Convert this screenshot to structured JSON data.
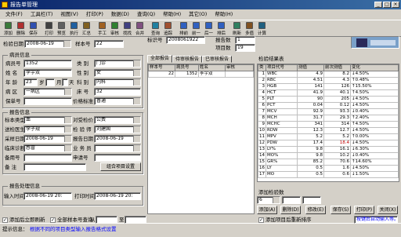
{
  "window": {
    "title": "报告单管理"
  },
  "menu": [
    "文件(F)",
    "工具栏(T)",
    "视图(V)",
    "打印(P)",
    "数据(D)",
    "查询(Q)",
    "帮助(H)",
    "其它(O)",
    "帮助(H)"
  ],
  "toolbar": {
    "buttons": [
      "添加",
      "删除",
      "保存",
      "打印",
      "预览",
      "执行",
      "汇总",
      "手工",
      "审核",
      "找找",
      "合并",
      "查询",
      "追踪",
      "排前",
      "前一",
      "后一",
      "排后",
      "刷新",
      "多值",
      "计算"
    ]
  },
  "top": {
    "sample_date_label": "检验日期",
    "sample_date": "2008-06-19",
    "sample_no_label": "样本号",
    "sample_no": "22",
    "barcode_label": "标识号",
    "barcode": "2008061922",
    "report_count_label": "报告数",
    "report_count": "1",
    "item_count_label": "项目数",
    "item_count": "19"
  },
  "patient": {
    "group_title": "病员信息",
    "case_no_label": "病员号",
    "case_no": "1352",
    "type_label": "类 别",
    "type": "门诊",
    "name_label": "姓 名",
    "name": "李宇双",
    "sex_label": "性 别",
    "sex": "女",
    "age_label": "年 龄",
    "age": "23",
    "age_unit1": "岁",
    "age_unit2": "月",
    "age_unit3": "天",
    "dept_label": "科 别",
    "dept": "内科",
    "ward_label": "病 区",
    "ward": "一病区",
    "bed_label": "床 号",
    "bed": "32",
    "insure_label": "保单号",
    "insure": "",
    "price_label": "价格标准",
    "price": "普通"
  },
  "report": {
    "group_title": "报告信息",
    "sample_type_label": "标本类型",
    "sample_type": "血",
    "ctrl_label": "对受检价",
    "ctrl": "公费",
    "doctor_label": "送检医生",
    "doctor": "李子规",
    "checker_label": "检 验 师",
    "checker": "刘建国",
    "collect_label": "采样日期",
    "collect": "2008-06-19",
    "report_date_label": "报告日期",
    "report_date": "2008-06-19",
    "clinic_label": "临床诊断",
    "clinic": "感冒",
    "op_label": "业 务 员",
    "op": "",
    "note_label": "备用号",
    "note": "",
    "applyno_label": "申请号",
    "applyno": "",
    "remark_label": "备 注",
    "remark": "",
    "combo_btn": "组合项目设置"
  },
  "process": {
    "group_title": "报告处理信息",
    "input_time_label": "输入时间",
    "input_time": "2008-06-19 20:",
    "print_time_label": "打印时间",
    "print_time": "2008-06-19 20:"
  },
  "list": {
    "tabs": [
      "全部报告",
      "待审核报告",
      "已审核报告"
    ],
    "headers": [
      "样本号",
      "病员号",
      "姓名",
      "审核"
    ],
    "rows": [
      [
        "22",
        "1352",
        "李宇双",
        ""
      ]
    ]
  },
  "results": {
    "title": "检验结果表",
    "headers": [
      "类",
      "项目代号",
      "测值",
      "前次测值",
      "变化"
    ],
    "rows": [
      [
        "1",
        "WBC",
        "4.9",
        "8.2",
        "↓4.50%"
      ],
      [
        "2",
        "RBC",
        "4.51",
        "4.3",
        "↑0.48%"
      ],
      [
        "3",
        "HGB",
        "141",
        "126",
        "↑15.50%"
      ],
      [
        "4",
        "HCT",
        "41.9",
        "40.1",
        "↑4.50%"
      ],
      [
        "5",
        "PLT",
        "90",
        "205",
        "↓4.50%"
      ],
      [
        "6",
        "PCT",
        "0.04",
        "0.12",
        "↓4.50%"
      ],
      [
        "7",
        "MCV",
        "92.9",
        "93.3",
        "↓0.40%"
      ],
      [
        "8",
        "MCH",
        "31.7",
        "29.3",
        "↑2.40%"
      ],
      [
        "9",
        "MCHC",
        "341",
        "314",
        "↑4.50%"
      ],
      [
        "10",
        "RDW",
        "12.3",
        "12.7",
        "↓4.50%"
      ],
      [
        "11",
        "MPV",
        "5.2",
        "5.2",
        "↑0.00%"
      ],
      [
        "12",
        "PDW",
        "17.4",
        "18.4",
        "↓4.50%"
      ],
      [
        "13",
        "LY%",
        "9.8",
        "16.1",
        "↓6.30%"
      ],
      [
        "14",
        "MO%",
        "9.8",
        "10.2",
        "↓0.40%"
      ],
      [
        "15",
        "GR%",
        "85.2",
        "70.6",
        "↑14.60%"
      ],
      [
        "16",
        "LY",
        "0.5",
        "1.6",
        "↓4.50%"
      ],
      [
        "17",
        "MO",
        "0.5",
        "0.6",
        "↓1.50%"
      ]
    ],
    "add_title": "添加检验数",
    "add_value": "6",
    "btn_add": "添加(A)",
    "btn_del": "删除(D)",
    "btn_modify": "修改(E)",
    "btn_save": "保存(S)",
    "btn_print": "打印(P)",
    "btn_exit": "关闭(X)"
  },
  "bottom": {
    "auto_add": "添加后立即刷新",
    "all_sample": "全部样本号查询",
    "from_label": "从",
    "to_label": "至",
    "result_resort": "添加项目后重新排序",
    "hint_label": "提示信息：",
    "hint": "根据不同的项目类型输入报告格式设置",
    "status_right": "按键后自动输入等。"
  }
}
